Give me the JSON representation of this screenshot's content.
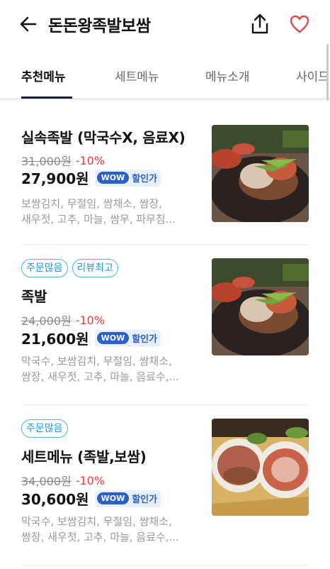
{
  "header": {
    "title": "돈돈왕족발보쌈"
  },
  "icons": {
    "back": "back-arrow-icon",
    "share": "share-icon",
    "favorite": "heart-icon"
  },
  "tabs": [
    {
      "label": "추천메뉴"
    },
    {
      "label": "세트메뉴"
    },
    {
      "label": "메뉴소개"
    },
    {
      "label": "사이드"
    }
  ],
  "wow": {
    "badge": "WOW",
    "text": "할인가"
  },
  "items": [
    {
      "badges": [],
      "name": "실속족발 (막국수X, 음료X)",
      "original_price": "31,000원",
      "discount": "-10%",
      "sale_price": "27,900원",
      "desc_line1": "보쌈김치, 무절임, 쌈채소, 쌈장,",
      "desc_line2": "새우젓, 고추, 마늘, 쌈무, 파무침..."
    },
    {
      "badges": [
        "주문많음",
        "리뷰최고"
      ],
      "name": "족발",
      "original_price": "24,000원",
      "discount": "-10%",
      "sale_price": "21,600원",
      "desc_line1": "막국수, 보쌈김치, 무절임, 쌈채소,",
      "desc_line2": "쌈장, 새우젓, 고추, 마늘, 음료수,..."
    },
    {
      "badges": [
        "주문많음"
      ],
      "name": "세트메뉴 (족발,보쌈)",
      "original_price": "34,000원",
      "discount": "-10%",
      "sale_price": "30,600원",
      "desc_line1": "막국수, 보쌈김치, 무절임, 쌈채소,",
      "desc_line2": "쌈장, 새우젓, 고추, 마늘, 음료수,..."
    }
  ],
  "colors": {
    "accent_blue": "#1c9bd6",
    "discount_red": "#e83b3b",
    "heart_red": "#e0474c",
    "wow_blue": "#2b60c9"
  }
}
